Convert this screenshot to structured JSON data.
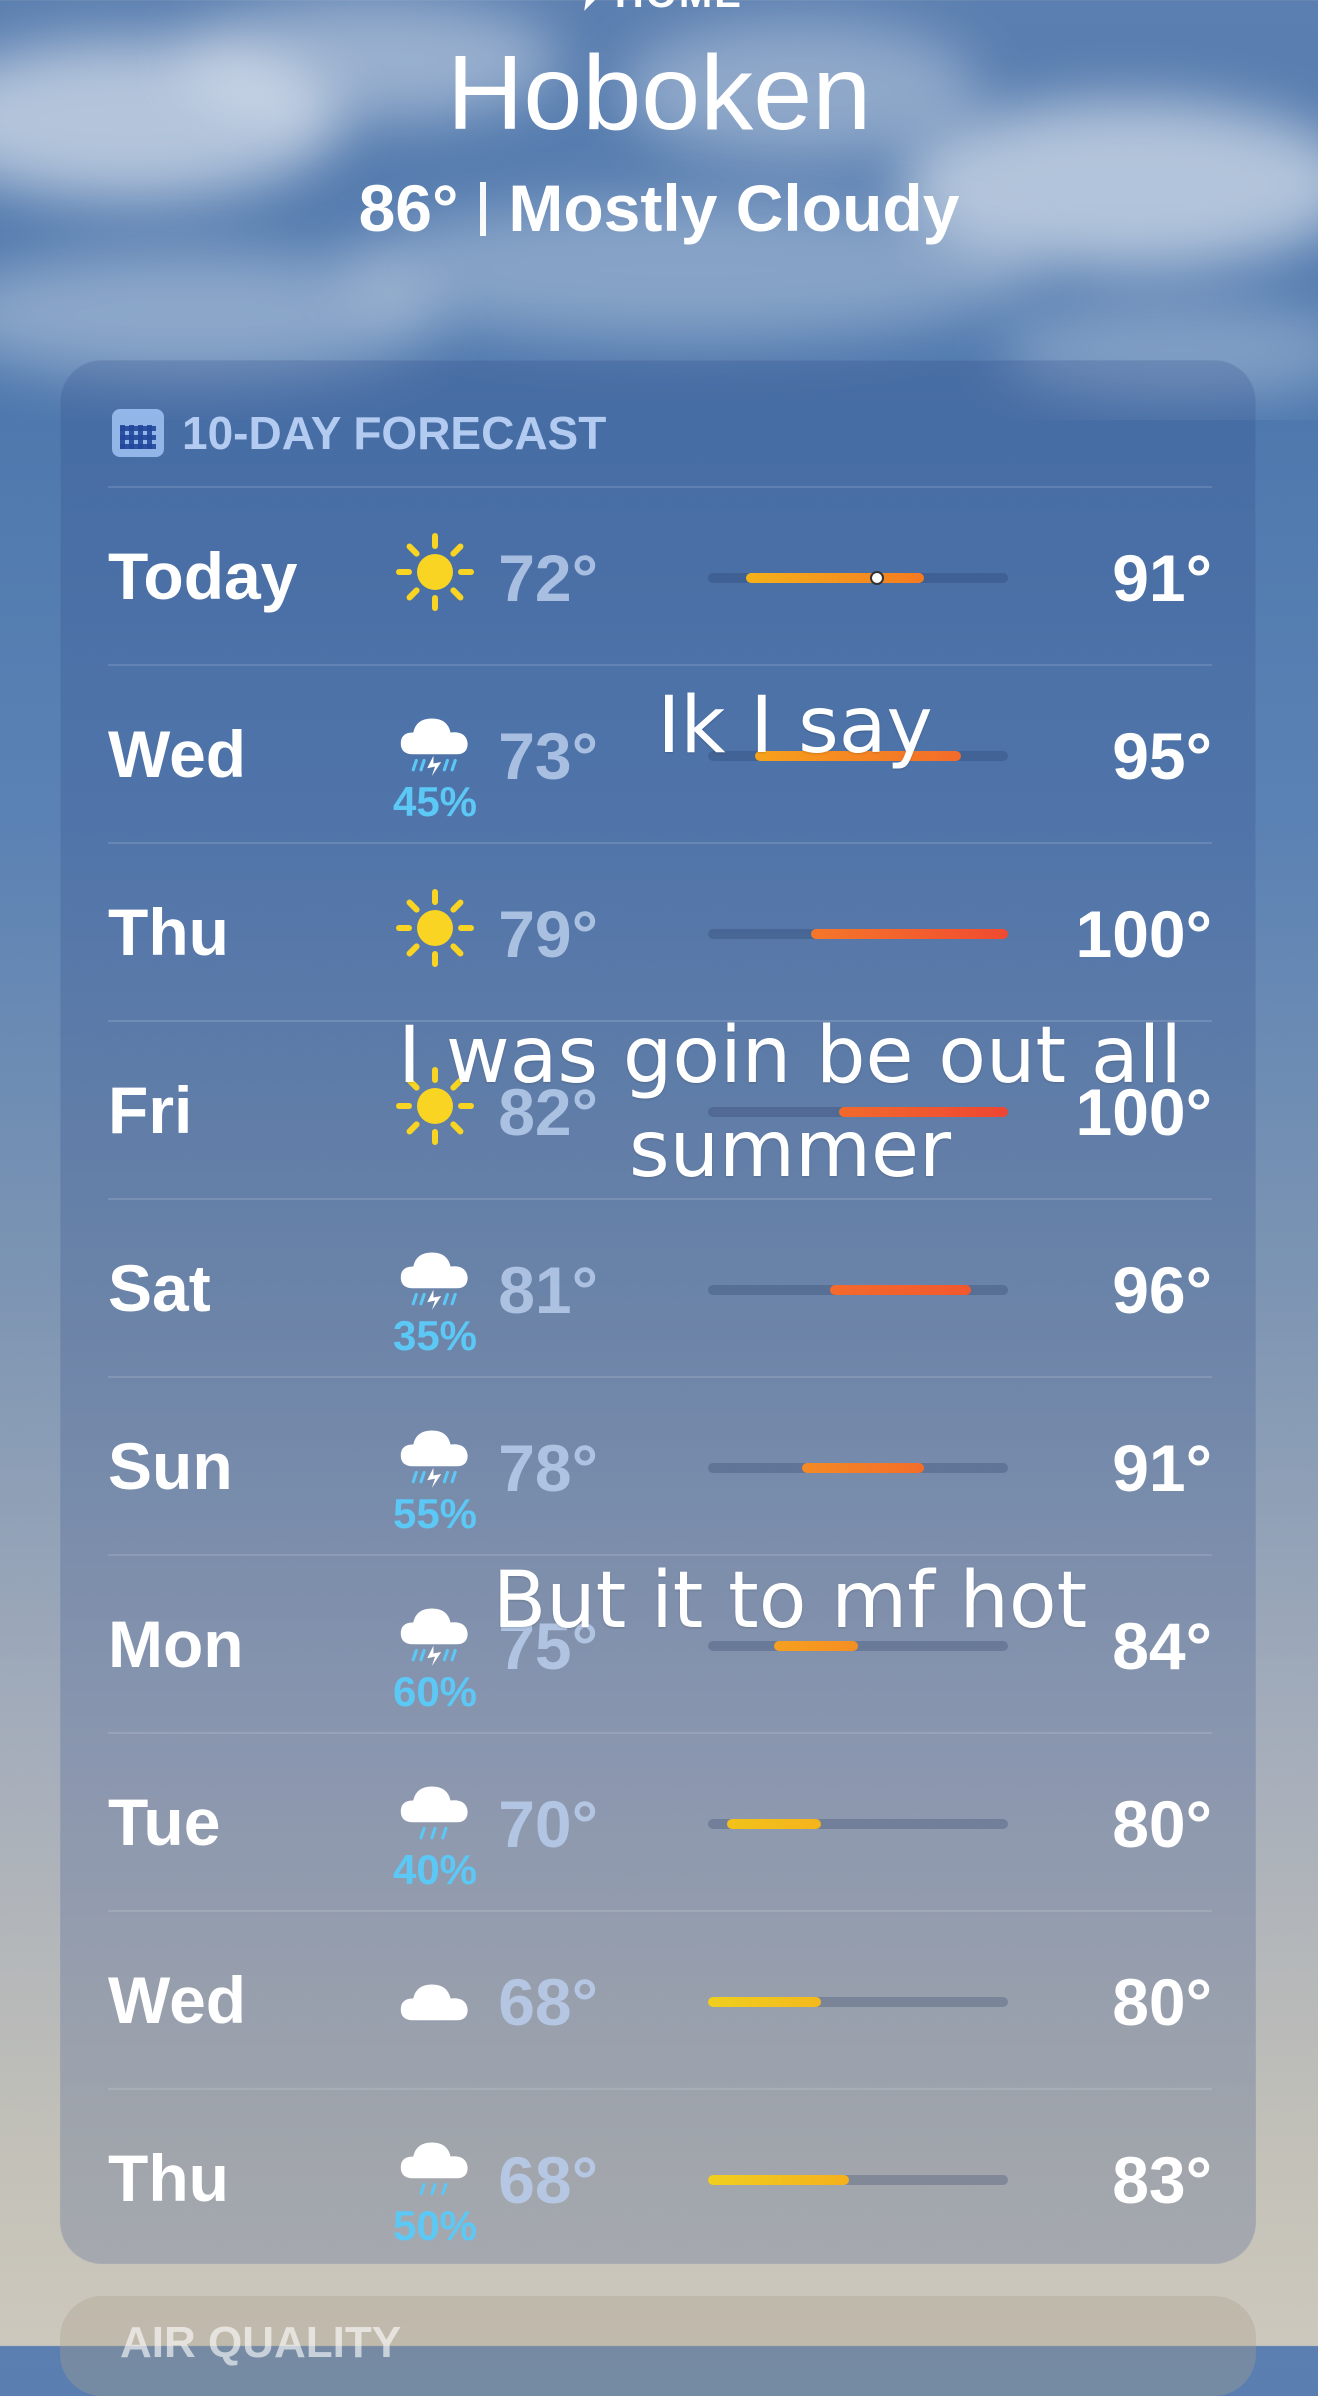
{
  "header": {
    "location_label": "HOME",
    "city": "Hoboken",
    "temperature": "86°",
    "condition": "Mostly Cloudy"
  },
  "forecast": {
    "title": "10-DAY FORECAST",
    "range_min": 68,
    "range_max": 100,
    "current_temp": 86,
    "days": [
      {
        "day": "Today",
        "icon": "sun-icon",
        "pop": "",
        "low": "72°",
        "high": "91°",
        "low_val": 72,
        "high_val": 91,
        "color_from": "#f5b21a",
        "color_to": "#f57a20",
        "show_dot": true
      },
      {
        "day": "Wed",
        "icon": "thunderstorm-icon",
        "pop": "45%",
        "low": "73°",
        "high": "95°",
        "low_val": 73,
        "high_val": 95,
        "color_from": "#f7a21b",
        "color_to": "#f36a2a",
        "show_dot": false
      },
      {
        "day": "Thu",
        "icon": "sun-icon",
        "pop": "",
        "low": "79°",
        "high": "100°",
        "low_val": 79,
        "high_val": 100,
        "color_from": "#f5772a",
        "color_to": "#f04a30",
        "show_dot": false
      },
      {
        "day": "Fri",
        "icon": "sun-icon",
        "pop": "",
        "low": "82°",
        "high": "100°",
        "low_val": 82,
        "high_val": 100,
        "color_from": "#f26a2c",
        "color_to": "#ee4632",
        "show_dot": false
      },
      {
        "day": "Sat",
        "icon": "thunderstorm-icon",
        "pop": "35%",
        "low": "81°",
        "high": "96°",
        "low_val": 81,
        "high_val": 96,
        "color_from": "#f46a2c",
        "color_to": "#f2582e",
        "show_dot": false
      },
      {
        "day": "Sun",
        "icon": "thunderstorm-icon",
        "pop": "55%",
        "low": "78°",
        "high": "91°",
        "low_val": 78,
        "high_val": 91,
        "color_from": "#f58a24",
        "color_to": "#f46d2a",
        "show_dot": false
      },
      {
        "day": "Mon",
        "icon": "thunderstorm-icon",
        "pop": "60%",
        "low": "75°",
        "high": "84°",
        "low_val": 75,
        "high_val": 84,
        "color_from": "#f6a01f",
        "color_to": "#f58e22",
        "show_dot": false
      },
      {
        "day": "Tue",
        "icon": "rain-icon",
        "pop": "40%",
        "low": "70°",
        "high": "80°",
        "low_val": 70,
        "high_val": 80,
        "color_from": "#f2c21a",
        "color_to": "#f4b41c",
        "show_dot": false
      },
      {
        "day": "Wed",
        "icon": "cloud-icon",
        "pop": "",
        "low": "68°",
        "high": "80°",
        "low_val": 68,
        "high_val": 80,
        "color_from": "#f0cf1e",
        "color_to": "#f4b91c",
        "show_dot": false
      },
      {
        "day": "Thu",
        "icon": "rain-icon",
        "pop": "50%",
        "low": "68°",
        "high": "83°",
        "low_val": 68,
        "high_val": 83,
        "color_from": "#f0cf1e",
        "color_to": "#f5b01c",
        "show_dot": false
      }
    ]
  },
  "overlay_captions": {
    "line1": "Ik I say",
    "line2": "I was goin be out all summer",
    "line3": "But it to mf hot"
  },
  "next_card": {
    "title": "AIR QUALITY"
  }
}
